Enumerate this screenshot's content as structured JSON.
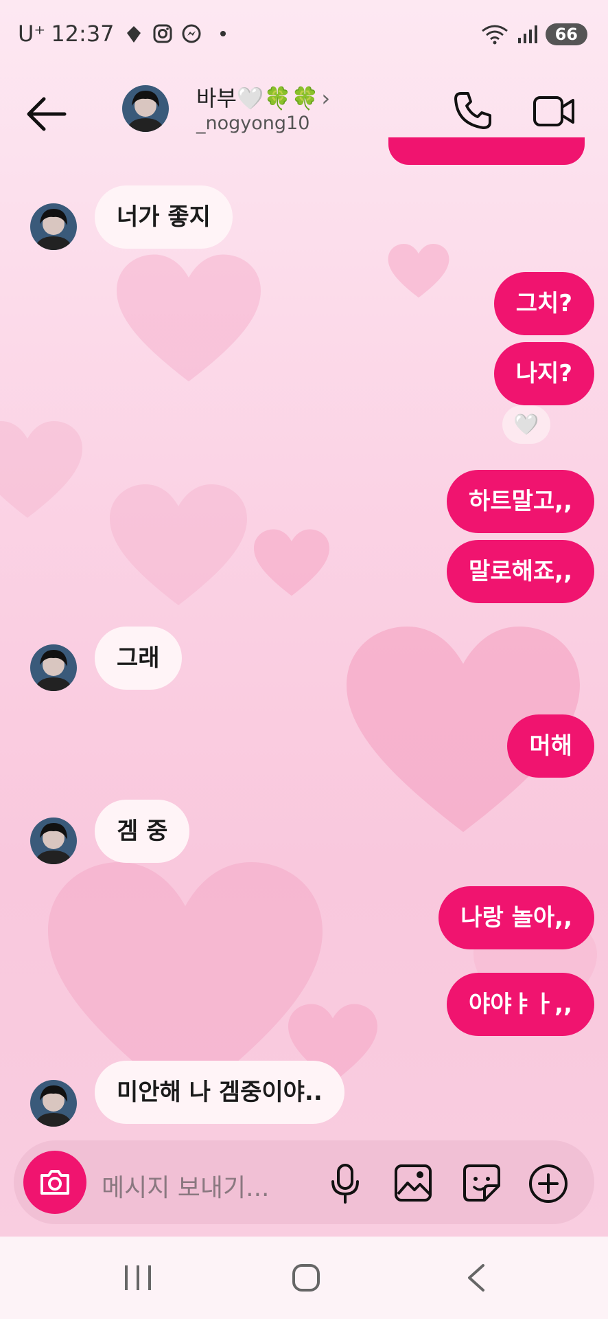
{
  "status_bar": {
    "carrier": "U⁺",
    "time": "12:37",
    "battery": "66"
  },
  "header": {
    "name": "바부🤍🍀🍀",
    "chevron": "›",
    "username": "_nogyong10"
  },
  "messages": [
    {
      "side": "in",
      "text": "너가 좋지"
    },
    {
      "side": "out",
      "text": "그치?"
    },
    {
      "side": "out",
      "text": "나지?"
    },
    {
      "side": "out",
      "text": "하트말고,,"
    },
    {
      "side": "out",
      "text": "말로해죠,,"
    },
    {
      "side": "in",
      "text": "그래"
    },
    {
      "side": "out",
      "text": "머해"
    },
    {
      "side": "in",
      "text": "겜 중"
    },
    {
      "side": "out",
      "text": "나랑 놀아,,"
    },
    {
      "side": "out",
      "text": "야야ㅑㅏ,,"
    },
    {
      "side": "in",
      "text": "미안해 나 겜중이야.."
    }
  ],
  "reaction": "🤍",
  "composer": {
    "placeholder": "메시지 보내기..."
  },
  "colors": {
    "accent": "#f0146f",
    "incoming_bubble": "#fff4f7"
  },
  "icons": [
    "back-arrow-icon",
    "phone-icon",
    "video-icon",
    "camera-icon",
    "microphone-icon",
    "gallery-icon",
    "sticker-icon",
    "plus-circle-icon",
    "recent-apps-icon",
    "home-icon",
    "back-nav-icon"
  ]
}
